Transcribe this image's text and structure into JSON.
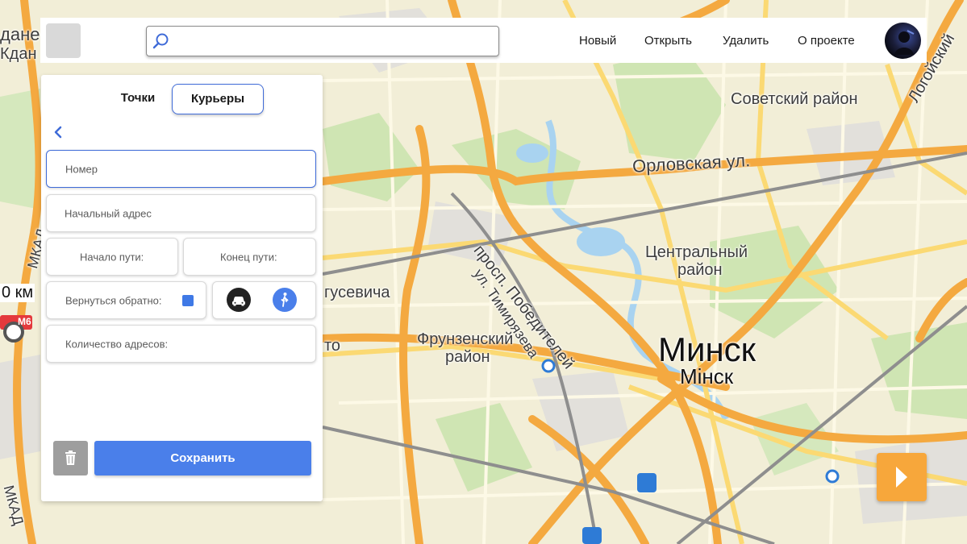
{
  "topbar": {
    "search_placeholder": "",
    "nav": [
      "Новый",
      "Открыть",
      "Удалить",
      "О проекте"
    ]
  },
  "panel": {
    "tabs": [
      {
        "label": "Точки",
        "active": false
      },
      {
        "label": "Курьеры",
        "active": true
      }
    ],
    "fields": {
      "number": "Номер",
      "start_address": "Начальный адрес",
      "path_start": "Начало пути:",
      "path_end": "Конец пути:",
      "return_back": "Вернуться обратно:",
      "address_count": "Количество адресов:"
    },
    "return_back_checked": true,
    "transport_modes": [
      "car-icon",
      "walk-icon"
    ],
    "save_label": "Сохранить"
  },
  "map": {
    "labels": {
      "city": "Минск",
      "city_by": "Мінск",
      "sovetsky": "Советский район",
      "tsentralny": "Центральный",
      "tsentralny2": "район",
      "frunzensky": "Фрунзенский",
      "frunzensky2": "район",
      "orlovskaya": "Орловская ул.",
      "pobediteley": "просп. Победителей",
      "timiryazeva": "ул. Тимирязева",
      "logoysky": "Логойский",
      "gusevicha": "гусевича",
      "to": "то",
      "mkad_left": "МКАД",
      "mkad_top": "МКАД",
      "km": "0 км",
      "m6": "M6",
      "kdan1": "дане",
      "kdan2": "Кдан"
    }
  },
  "colors": {
    "accent": "#3f6bd8",
    "save_button": "#4a7fea",
    "next_button": "#f7a73b"
  }
}
